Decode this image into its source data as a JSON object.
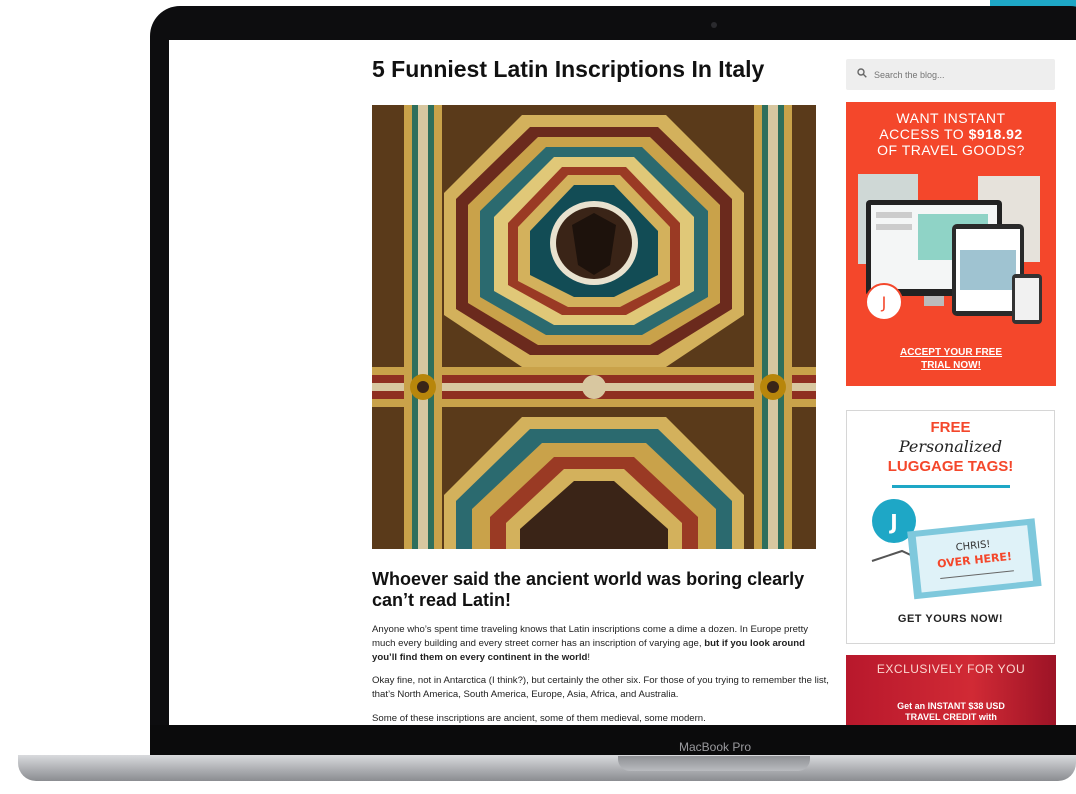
{
  "device": {
    "label": "MacBook Pro"
  },
  "post": {
    "title": "5 Funniest Latin Inscriptions In Italy",
    "hero_alt": "Ornate painted coffered ceiling with octagonal gilded frames",
    "subheading": "Whoever said the ancient world was boring clearly can’t read Latin!",
    "p1_text": "Anyone who’s spent time traveling knows that Latin inscriptions come a dime a dozen. In Europe pretty much every building and every street corner has an inscription of varying age, ",
    "p1_bold": "but if you look around you’ll find them on every continent in the world",
    "p1_end": "!",
    "p2": "Okay fine, not in Antarctica (I think?), but certainly the other six. For those of you trying to remember the list, that’s North America, South America, Europe, Asia, Africa, and Australia.",
    "p3": "Some of these inscriptions are ancient, some of them medieval, some modern."
  },
  "sidebar": {
    "search_placeholder": "Search the blog...",
    "ad1": {
      "line1": "WANT INSTANT",
      "line2_pre": "ACCESS TO ",
      "line2_price": "$918.92",
      "line3": "OF TRAVEL GOODS?",
      "logo_letter": "J",
      "cta1": "ACCEPT YOUR FREE",
      "cta2": "TRIAL NOW!"
    },
    "ad2": {
      "free": "FREE",
      "script": "Personalized",
      "tags": "LUGGAGE TAGS!",
      "logo_letter": "J",
      "tag_line1": "CHRIS!",
      "tag_line2": "OVER HERE!",
      "cta": "GET YOURS NOW!"
    },
    "ad3": {
      "head": "EXCLUSIVELY FOR YOU",
      "line1": "Get an INSTANT $38 USD",
      "line2": "TRAVEL CREDIT with"
    }
  },
  "colors": {
    "accent": "#f4472b",
    "teal": "#1ea7c6"
  }
}
